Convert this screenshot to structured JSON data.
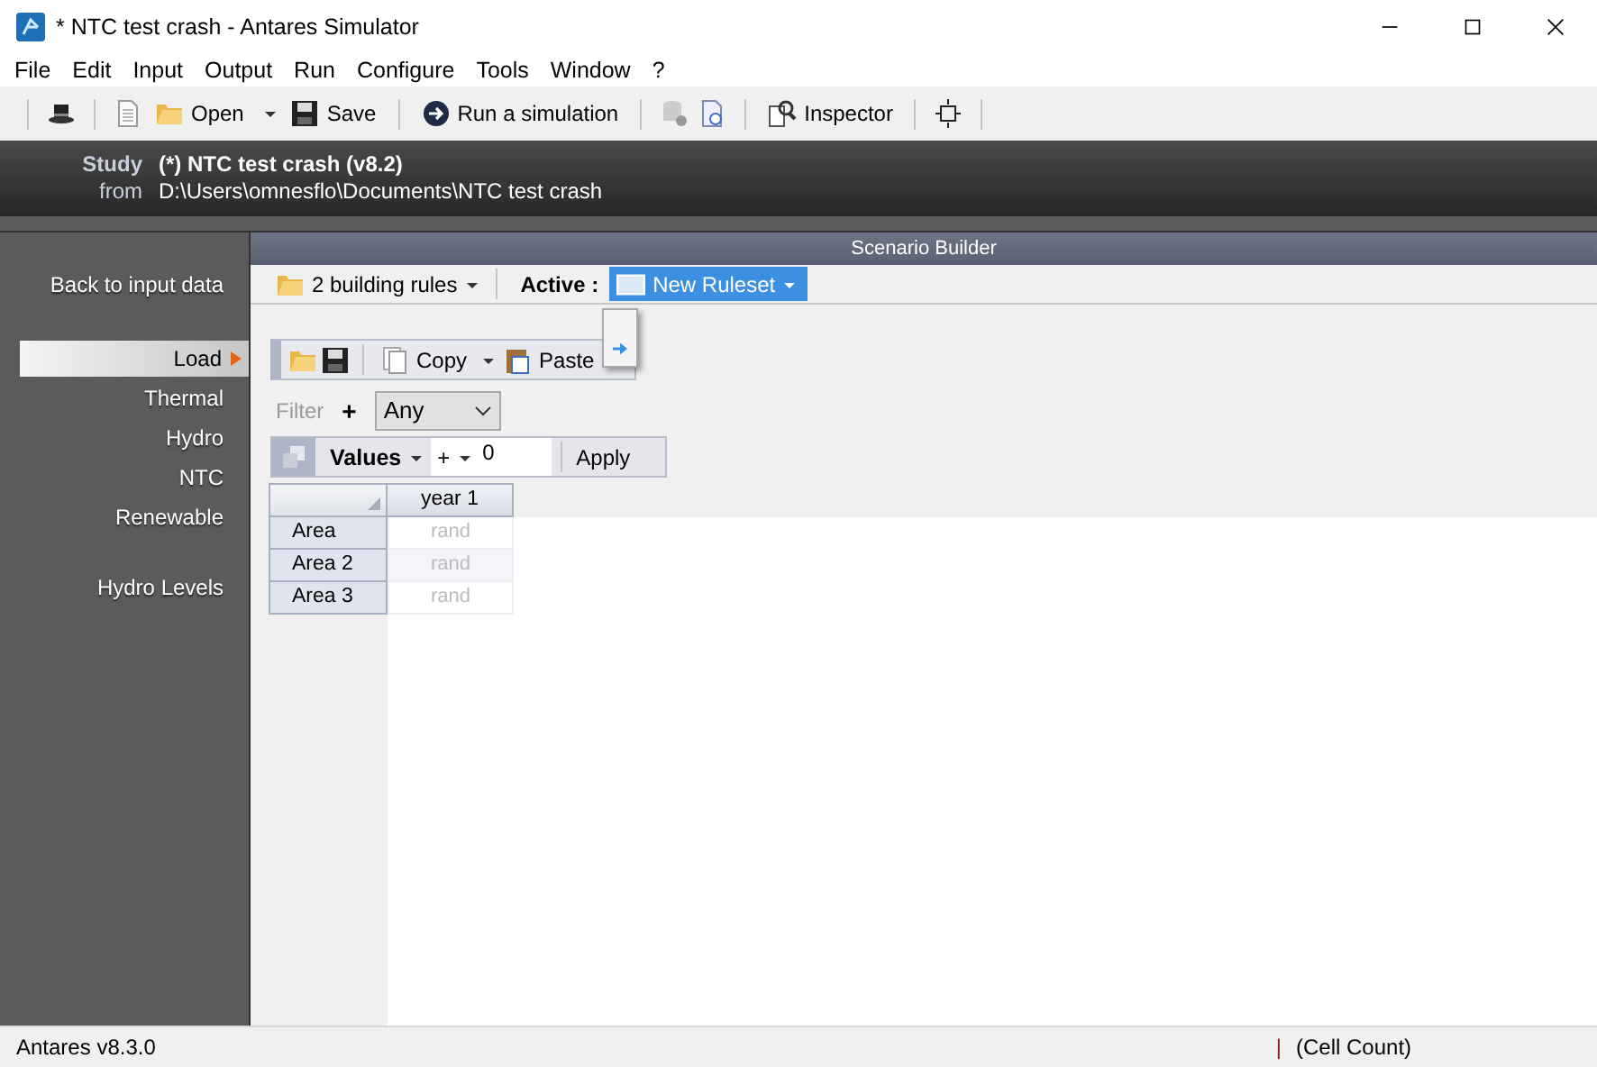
{
  "window": {
    "title": "* NTC test crash - Antares Simulator"
  },
  "menu": [
    "File",
    "Edit",
    "Input",
    "Output",
    "Run",
    "Configure",
    "Tools",
    "Window",
    "?"
  ],
  "toolbar": {
    "open": "Open",
    "save": "Save",
    "run": "Run a simulation",
    "inspector": "Inspector"
  },
  "study": {
    "label": "Study",
    "name": "(*) NTC test crash (v8.2)",
    "from_label": "from",
    "path": "D:\\Users\\omnesflo\\Documents\\NTC test crash"
  },
  "sidebar": {
    "back": "Back to input data",
    "groups": [
      {
        "items": [
          {
            "label": "Load",
            "selected": true
          },
          {
            "label": "Thermal",
            "selected": false
          },
          {
            "label": "Hydro",
            "selected": false
          },
          {
            "label": "NTC",
            "selected": false
          },
          {
            "label": "Renewable",
            "selected": false
          }
        ]
      },
      {
        "items": [
          {
            "label": "Hydro Levels",
            "selected": false
          }
        ]
      }
    ]
  },
  "panel": {
    "title": "Scenario Builder",
    "rules": "2 building rules",
    "active_label": "Active :",
    "active_value": "New Ruleset",
    "copy": "Copy",
    "paste": "Paste",
    "filter_label": "Filter",
    "filter_op": "+",
    "filter_value": "Any",
    "values_label": "Values",
    "op": "+",
    "value": "0",
    "apply": "Apply"
  },
  "table": {
    "columns": [
      "year 1"
    ],
    "rows": [
      {
        "area": "Area",
        "cells": [
          "rand"
        ]
      },
      {
        "area": "Area 2",
        "cells": [
          "rand"
        ]
      },
      {
        "area": "Area 3",
        "cells": [
          "rand"
        ]
      }
    ]
  },
  "status_bar": {
    "left": "Antares v8.3.0",
    "separator": "|",
    "right": "(Cell Count)"
  }
}
